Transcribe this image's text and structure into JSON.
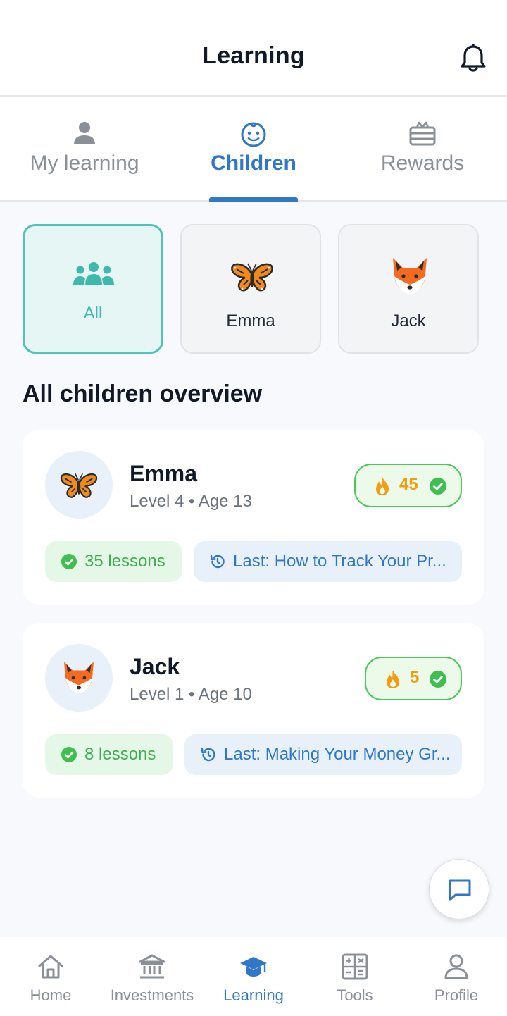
{
  "header": {
    "title": "Learning",
    "bell_icon": "bell-icon"
  },
  "tabs": [
    {
      "label": "My learning",
      "icon": "person-icon",
      "active": false
    },
    {
      "label": "Children",
      "icon": "child-face-icon",
      "active": true
    },
    {
      "label": "Rewards",
      "icon": "gift-icon",
      "active": false
    }
  ],
  "child_selector": [
    {
      "label": "All",
      "icon": "group-icon",
      "selected": true
    },
    {
      "label": "Emma",
      "icon": "butterfly-icon",
      "selected": false
    },
    {
      "label": "Jack",
      "icon": "fox-icon",
      "selected": false
    }
  ],
  "overview": {
    "title": "All children overview",
    "children": [
      {
        "name": "Emma",
        "meta": "Level 4 • Age 13",
        "avatar": "butterfly-icon",
        "streak": "45",
        "lessons": "35 lessons",
        "last": "Last: How to Track Your Pr..."
      },
      {
        "name": "Jack",
        "meta": "Level 1 • Age 10",
        "avatar": "fox-icon",
        "streak": "5",
        "lessons": "8 lessons",
        "last": "Last: Making Your Money Gr..."
      }
    ]
  },
  "bottom_nav": [
    {
      "label": "Home",
      "icon": "home-icon",
      "active": false
    },
    {
      "label": "Investments",
      "icon": "bank-icon",
      "active": false
    },
    {
      "label": "Learning",
      "icon": "graduation-cap-icon",
      "active": true
    },
    {
      "label": "Tools",
      "icon": "calculator-icon",
      "active": false
    },
    {
      "label": "Profile",
      "icon": "profile-icon",
      "active": false
    }
  ],
  "colors": {
    "accent": "#2f78c8",
    "teal": "#4fc4b9",
    "green": "#4cc85a",
    "streak": "#f39c12"
  }
}
